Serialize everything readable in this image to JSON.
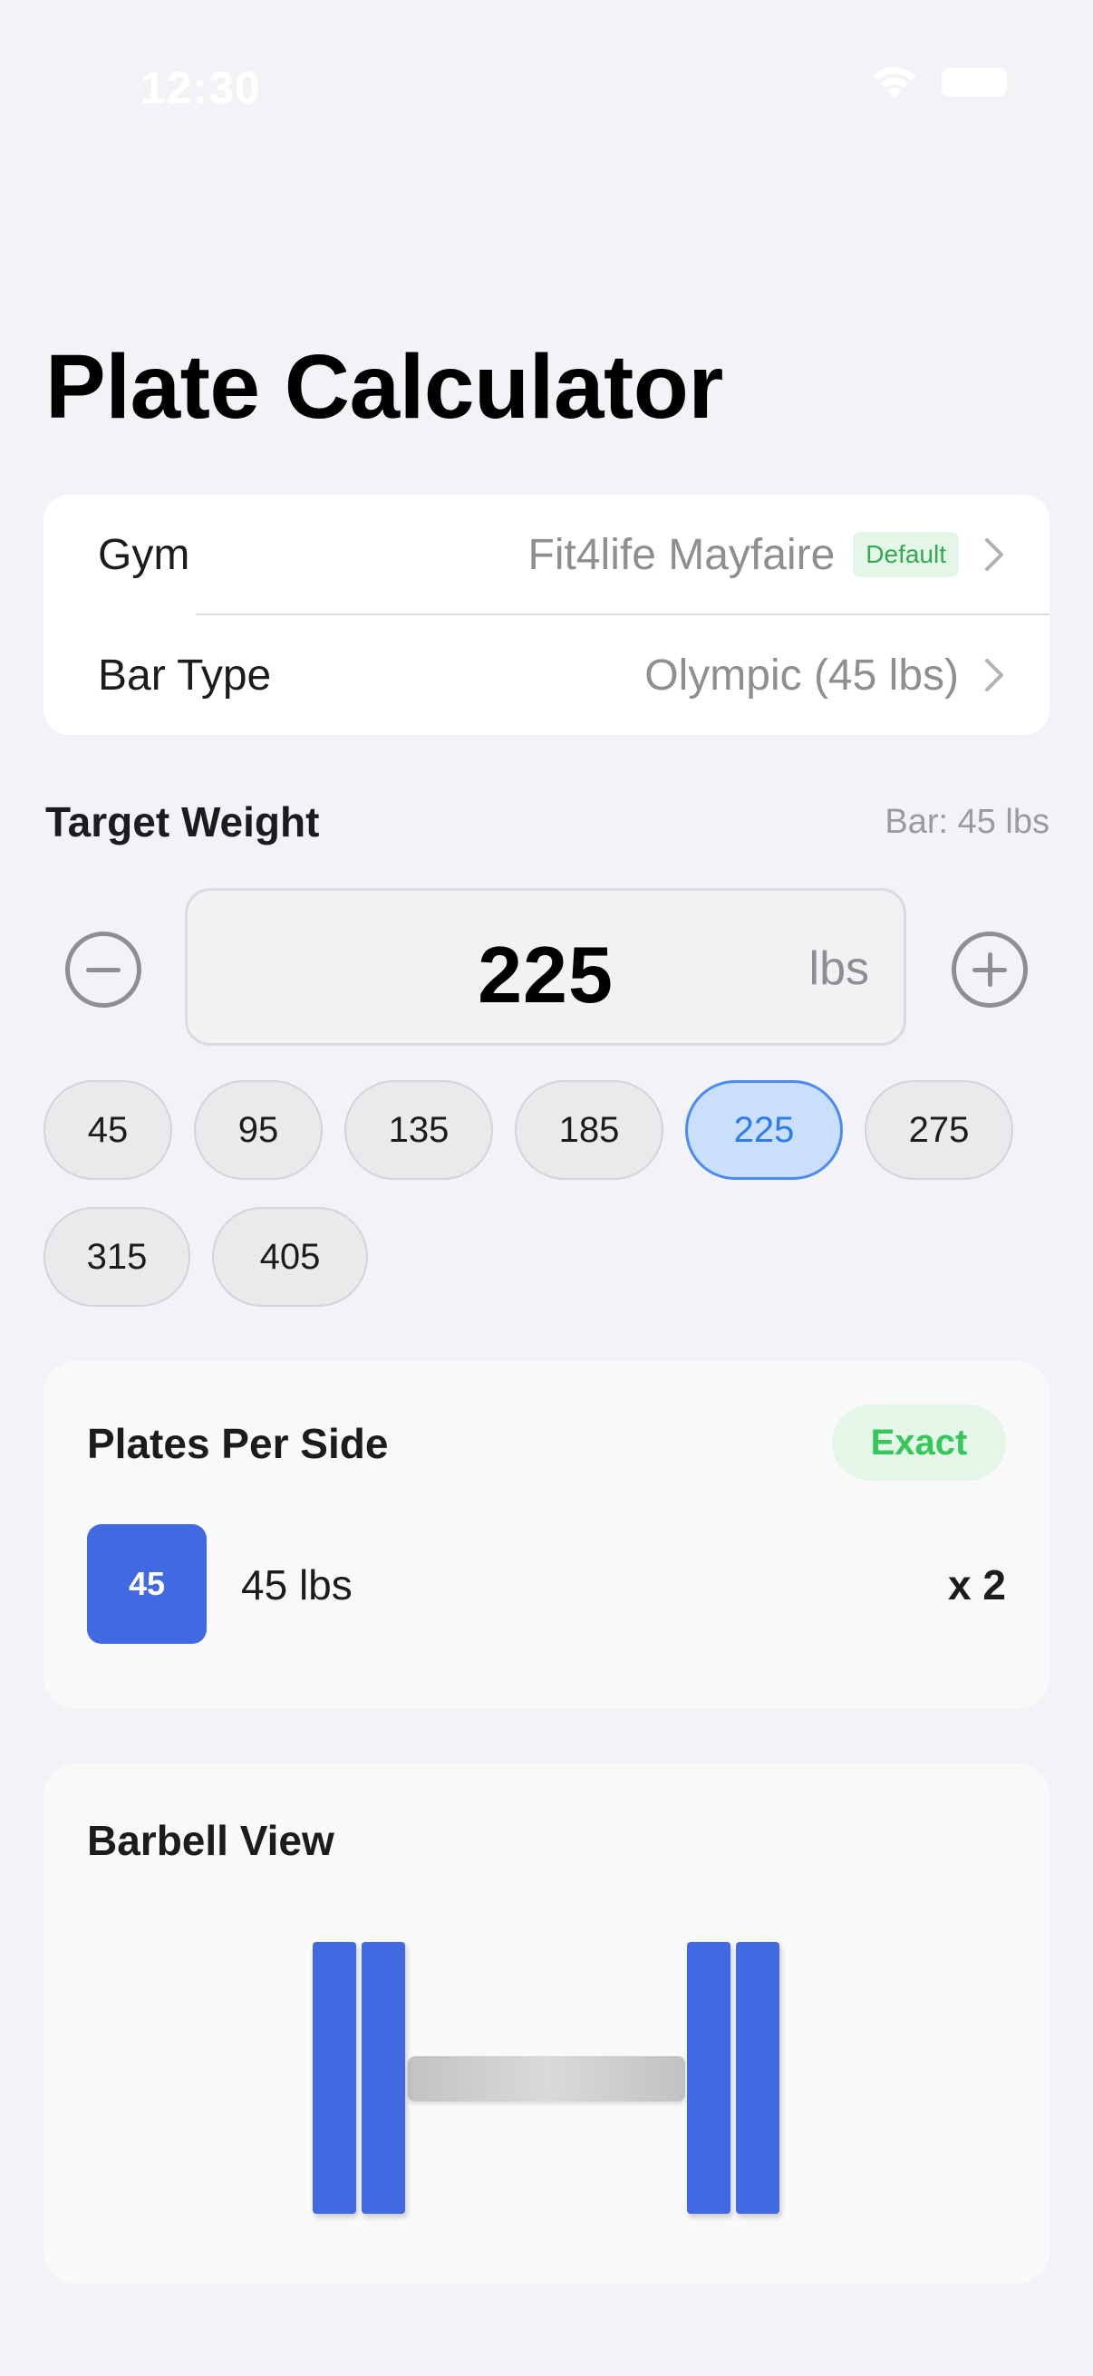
{
  "status_bar": {
    "time": "12:30"
  },
  "page_title": "Plate Calculator",
  "settings": {
    "gym": {
      "label": "Gym",
      "value": "Fit4life Mayfaire",
      "badge": "Default"
    },
    "bar_type": {
      "label": "Bar Type",
      "value": "Olympic (45 lbs)"
    }
  },
  "target": {
    "label": "Target Weight",
    "bar_note": "Bar: 45 lbs",
    "value": "225",
    "unit": "lbs"
  },
  "presets": [
    "45",
    "95",
    "135",
    "185",
    "225",
    "275",
    "315",
    "405"
  ],
  "selected_preset": "225",
  "plates_per_side": {
    "title": "Plates Per Side",
    "status": "Exact",
    "plates": [
      {
        "swatch_label": "45",
        "description": "45 lbs",
        "count": "x 2",
        "color": "#4169E1"
      }
    ]
  },
  "barbell_view": {
    "title": "Barbell View",
    "plates_per_side": 2,
    "plate_color": "#4169E1"
  },
  "colors": {
    "accent": "#2E7BEA",
    "success": "#34C759",
    "plate_blue": "#4169E1",
    "background": "#F2F2F7"
  }
}
